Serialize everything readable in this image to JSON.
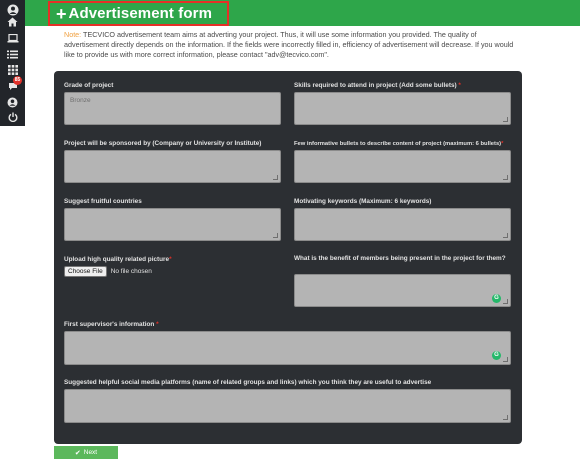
{
  "sidebar": {
    "items": [
      {
        "icon": "user-avatar-icon"
      },
      {
        "icon": "home-icon"
      },
      {
        "icon": "laptop-icon"
      },
      {
        "icon": "list-icon"
      },
      {
        "icon": "grid-icon"
      },
      {
        "icon": "chat-icon",
        "badge": "85"
      },
      {
        "icon": "account-icon"
      },
      {
        "icon": "power-icon"
      }
    ]
  },
  "header": {
    "title_icon": "+",
    "title": "Advertisement form"
  },
  "notice": {
    "label": "Note:",
    "text": " TECVICO advertisement team aims at adverting your project. Thus, it will use some information you provided. The quality of advertisement directly depends on the information. If the fields were incorrectly filled in, efficiency of advertisement will decrease. If you would like to provide us with more correct information, please contact \"adv@tecvico.com\"."
  },
  "form": {
    "grade_label": "Grade of project",
    "grade_value": "Bronze",
    "skills_label": "Skills required to attend in project (Add some bullets)",
    "sponsor_label": "Project will be sponsored by (Company or University or Institute)",
    "bullets_label": "Few informative bullets to describe content of project (maximum: 6 bullets)",
    "countries_label": "Suggest fruitful countries",
    "keywords_label": "Motivating keywords (Maximum: 6 keywords)",
    "picture_label": "Upload high quality related picture",
    "choose_file": "Choose File",
    "no_file": "No file chosen",
    "benefit_label": "What is the benefit of members being present in the project for them?",
    "supervisor_label": "First supervisor's information",
    "social_label": "Suggested helpful social media platforms (name of related groups and links) which you think they are useful to advertise",
    "required_mark": "*"
  },
  "footer": {
    "next_label": "Next"
  },
  "colors": {
    "header_green": "#2ea64a",
    "highlight_red": "#e53027",
    "card_bg": "#2c2f33",
    "next_green": "#5cb85c"
  }
}
